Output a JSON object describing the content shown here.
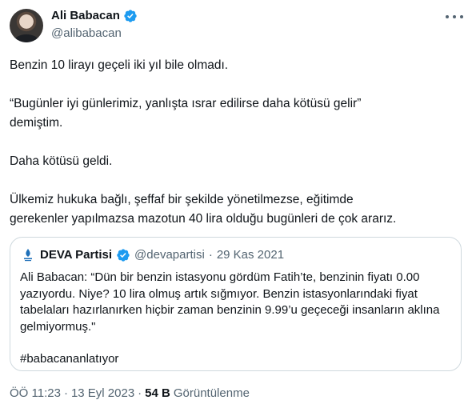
{
  "author": {
    "display_name": "Ali Babacan",
    "handle": "@alibabacan",
    "verified_color": "#1d9bf0"
  },
  "tweet": {
    "paragraphs": [
      "Benzin 10 lirayı geçeli iki yıl bile olmadı.",
      "“Bugünler iyi günlerimiz, yanlışta ısrar edilirse daha kötüsü gelir”\ndemiştim.",
      "Daha kötüsü geldi.",
      "Ülkemiz hukuka bağlı, şeffaf bir şekilde yönetilmezse, eğitimde\ngerekenler yapılmazsa mazotun 40 lira olduğu bugünleri de çok ararız."
    ]
  },
  "quote": {
    "display_name": "DEVA Partisi",
    "handle": "@devapartisi",
    "separator": "·",
    "date": "29 Kas 2021",
    "paragraphs": [
      "Ali Babacan: “Dün bir benzin istasyonu gördüm Fatih’te, benzinin fiyatı 0.00\nyazıyordu. Niye? 10 lira olmuş artık sığmıyor. Benzin istasyonlarındaki fiyat\ntabelaları hazırlanırken hiçbir zaman benzinin 9.99’u geçeceği insanların aklına\ngelmiyormuş.\"",
      "#babacananlatıyor"
    ]
  },
  "meta": {
    "time": "ÖÖ 11:23",
    "separator": "·",
    "date": "13 Eyl 2023",
    "views_count": "54 B",
    "views_label": "Görüntülenme"
  },
  "icons": {
    "more": "more-icon",
    "verified": "verified-badge-icon",
    "deva_logo": "deva-logo-icon"
  }
}
